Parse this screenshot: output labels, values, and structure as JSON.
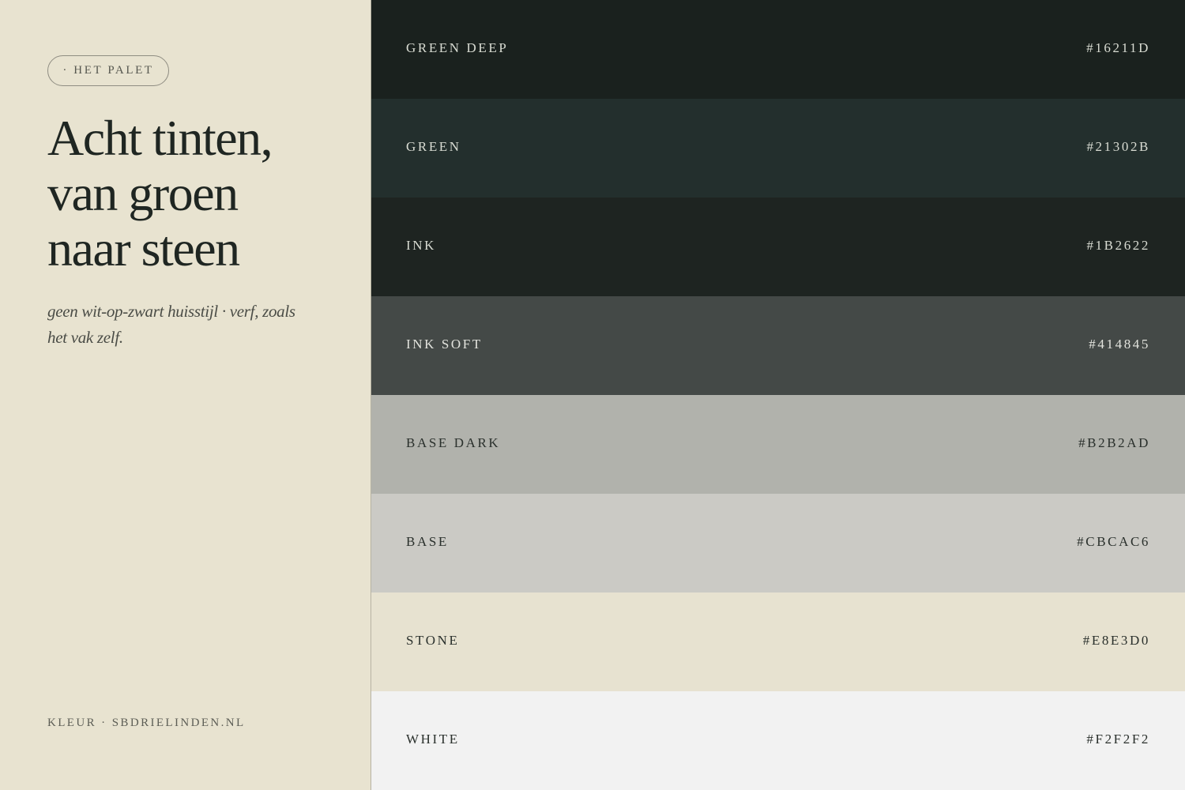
{
  "sidebar": {
    "badge": "· HET PALET",
    "title_lines": [
      "Acht tinten,",
      "van groen",
      "naar steen"
    ],
    "subtitle": "geen wit-op-zwart huisstijl · verf, zoals het vak zelf.",
    "footer": "KLEUR · SBDRIELINDEN.NL"
  },
  "swatches": [
    {
      "name": "GREEN DEEP",
      "hex_label": "#16211D",
      "color": "#1A211E",
      "text_color": "#D9DCD3"
    },
    {
      "name": "GREEN",
      "hex_label": "#21302B",
      "color": "#232F2D",
      "text_color": "#D9DCD3"
    },
    {
      "name": "INK",
      "hex_label": "#1B2622",
      "color": "#1E2421",
      "text_color": "#D9DCD3"
    },
    {
      "name": "INK SOFT",
      "hex_label": "#414845",
      "color": "#444947",
      "text_color": "#E3E4DE"
    },
    {
      "name": "BASE DARK",
      "hex_label": "#B2B2AD",
      "color": "#B1B2AC",
      "text_color": "#2A302C"
    },
    {
      "name": "BASE",
      "hex_label": "#CBCAC6",
      "color": "#CBCAC5",
      "text_color": "#2A302C"
    },
    {
      "name": "STONE",
      "hex_label": "#E8E3D0",
      "color": "#E7E2D0",
      "text_color": "#2A302C"
    },
    {
      "name": "WHITE",
      "hex_label": "#F2F2F2",
      "color": "#F2F2F2",
      "text_color": "#2A302C"
    }
  ]
}
